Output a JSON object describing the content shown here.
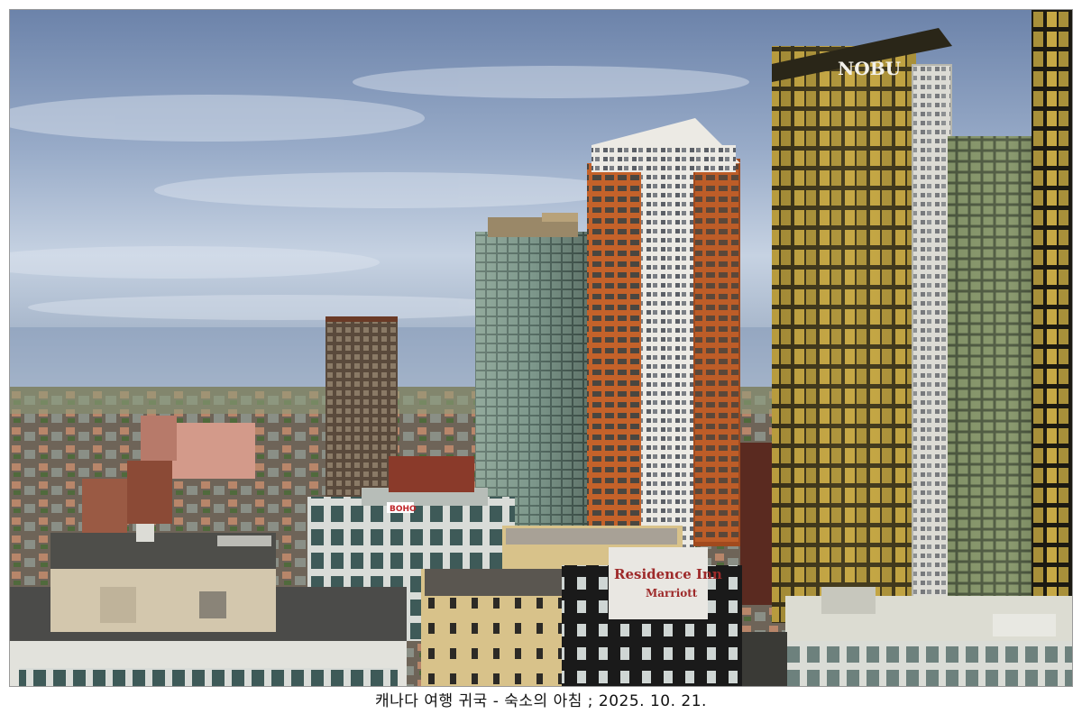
{
  "photo": {
    "signs": {
      "nobu": "NOBU",
      "residence_inn": "Residence Inn",
      "marriott": "Marriott",
      "hotel_sign": "BOHO"
    },
    "colors": {
      "sky_top": "#6f86ad",
      "sky_mid": "#b7c6dc",
      "horizon": "#dfe6ef",
      "gold_glass": "#b89a3c",
      "dark_glass": "#1c1a12",
      "orange_frame": "#c4622a",
      "white_facade": "#eceae4",
      "sandstone": "#d8c28a",
      "roof_grey": "#4a4a48"
    }
  },
  "caption": "캐나다 여행 귀국 - 숙소의 아침 ; 2025. 10. 21."
}
